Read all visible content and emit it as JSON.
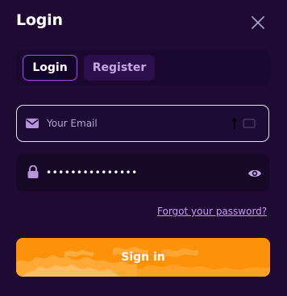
{
  "modal": {
    "title": "Login",
    "close_icon": "close-icon"
  },
  "tabs": [
    {
      "label": "Login",
      "active": true
    },
    {
      "label": "Register",
      "active": false
    }
  ],
  "email": {
    "icon": "envelope-icon",
    "placeholder": "Your Email",
    "value": ""
  },
  "password": {
    "icon": "lock-icon",
    "value": "•••••••••••••••",
    "toggle_icon": "eye-icon"
  },
  "forgot_password": "Forgot your password?",
  "sign_in": "Sign in",
  "colors": {
    "background": "#1f0a33",
    "accent_border": "#a64ef0",
    "button": "#fb920a",
    "link": "#c99af5"
  }
}
